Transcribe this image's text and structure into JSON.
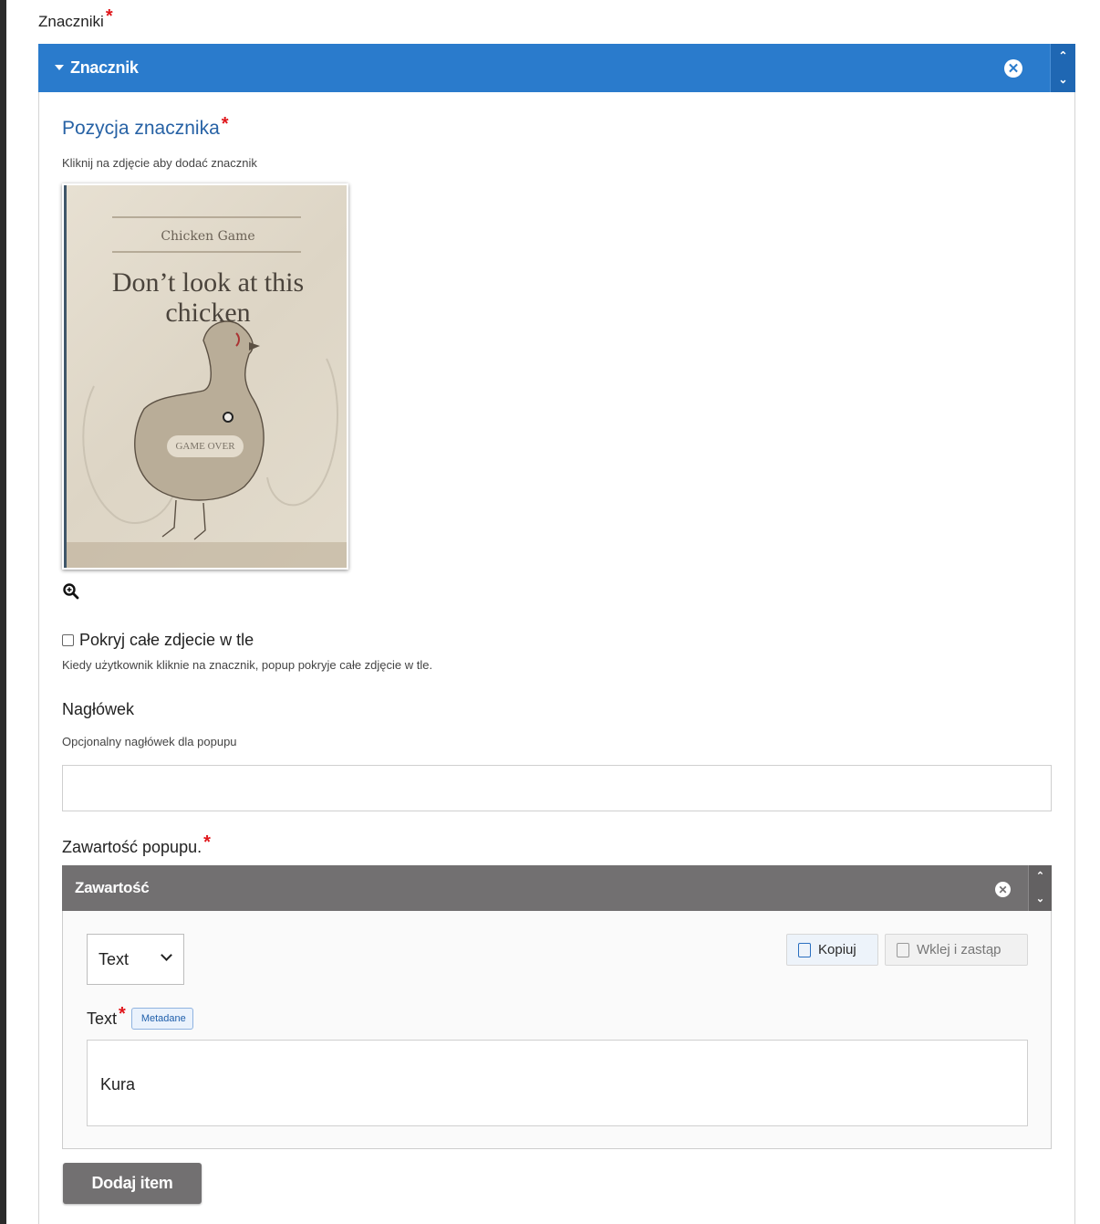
{
  "section": {
    "label": "Znaczniki",
    "required_mark": "*"
  },
  "group": {
    "title": "Znacznik",
    "body": {
      "position": {
        "title": "Pozycja znacznika",
        "required_mark": "*",
        "hint": "Kliknij na zdjęcie aby dodać znacznik",
        "image": {
          "subtitle": "Chicken Game",
          "title_line1": "Don’t look at this",
          "title_line2": "chicken",
          "badge": "GAME OVER"
        }
      },
      "cover": {
        "label": "Pokryj całe zdjecie w tle",
        "checked": false,
        "description": "Kiedy użytkownik kliknie na znacznik, popup pokryje całe zdjęcie w tle."
      },
      "heading": {
        "label": "Nagłówek",
        "description": "Opcjonalny nagłówek dla popupu",
        "value": ""
      },
      "popup_content": {
        "label": "Zawartość popupu.",
        "required_mark": "*",
        "group_title": "Zawartość",
        "library_select": "Text",
        "copy_button": "Kopiuj",
        "paste_button": "Wklej i zastąp",
        "text_label": "Text",
        "text_required_mark": "*",
        "metadata_tag": "Metadane",
        "text_value": "Kura"
      },
      "add_item_button": "Dodaj item"
    }
  },
  "colors": {
    "accent": "#2a7bcc",
    "required": "#e0161b",
    "subgroup": "#727071"
  }
}
